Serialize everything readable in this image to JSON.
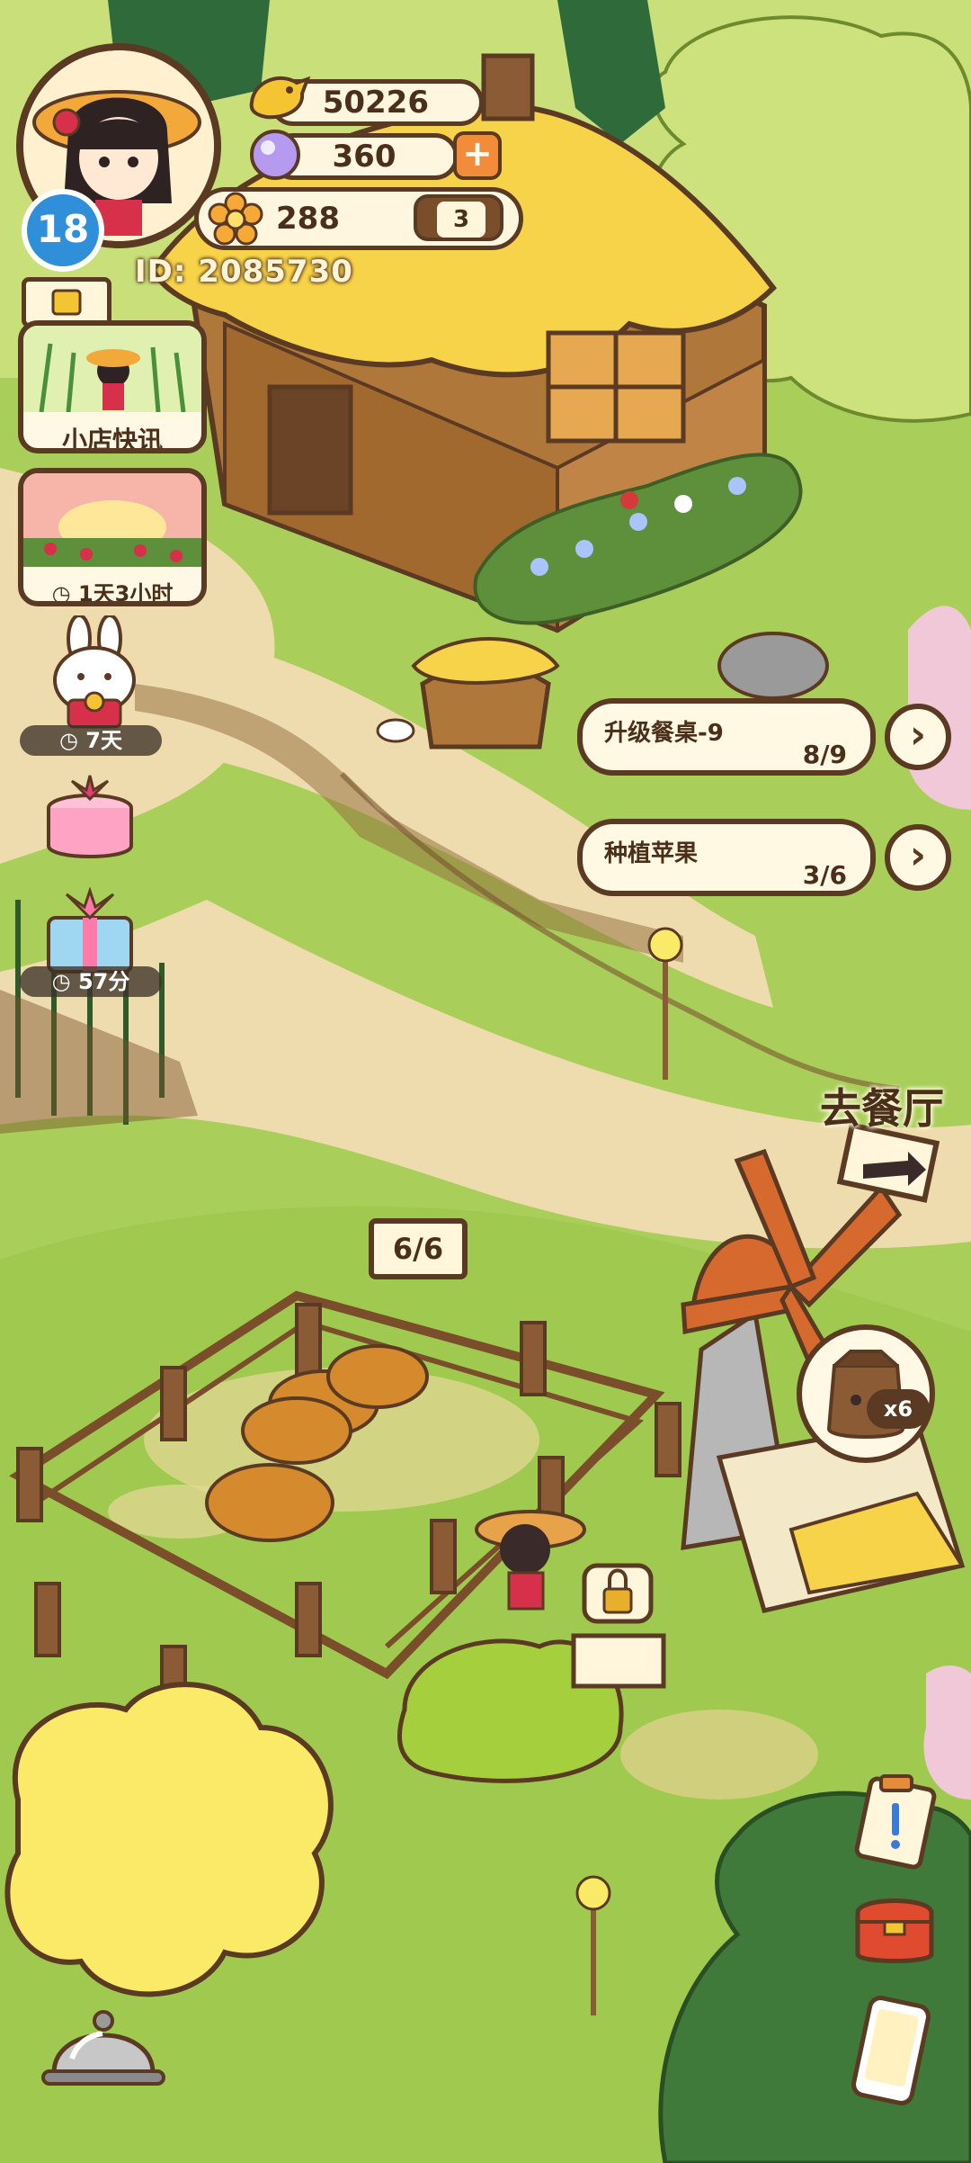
{
  "hud": {
    "coins": "50226",
    "gems": "360",
    "flowers": "288",
    "bird_count": "3",
    "player_id": "ID: 2085730",
    "level": "18"
  },
  "side_menu": {
    "news_label": "小店快讯",
    "event_timer": "1天3小时",
    "bunny_timer": "7天",
    "gift_timer": "57分"
  },
  "quests": [
    {
      "title": "升级餐桌-9",
      "progress": "8/9"
    },
    {
      "title": "种植苹果",
      "progress": "3/6"
    }
  ],
  "world": {
    "goto_restaurant": "去餐厅",
    "pen_count": "6/6",
    "windmill_output": "x6"
  },
  "colors": {
    "outline": "#5a3a22",
    "panel": "#fff8e2",
    "grass": "#a9cf5a",
    "path": "#efdcae",
    "level_badge": "#2f8fd8"
  },
  "icons": {
    "coin": "yellow-bird-coin-icon",
    "gem": "purple-pearl-icon",
    "flower": "orange-flower-icon",
    "add": "plus-icon",
    "next": "chevron-right-icon"
  }
}
